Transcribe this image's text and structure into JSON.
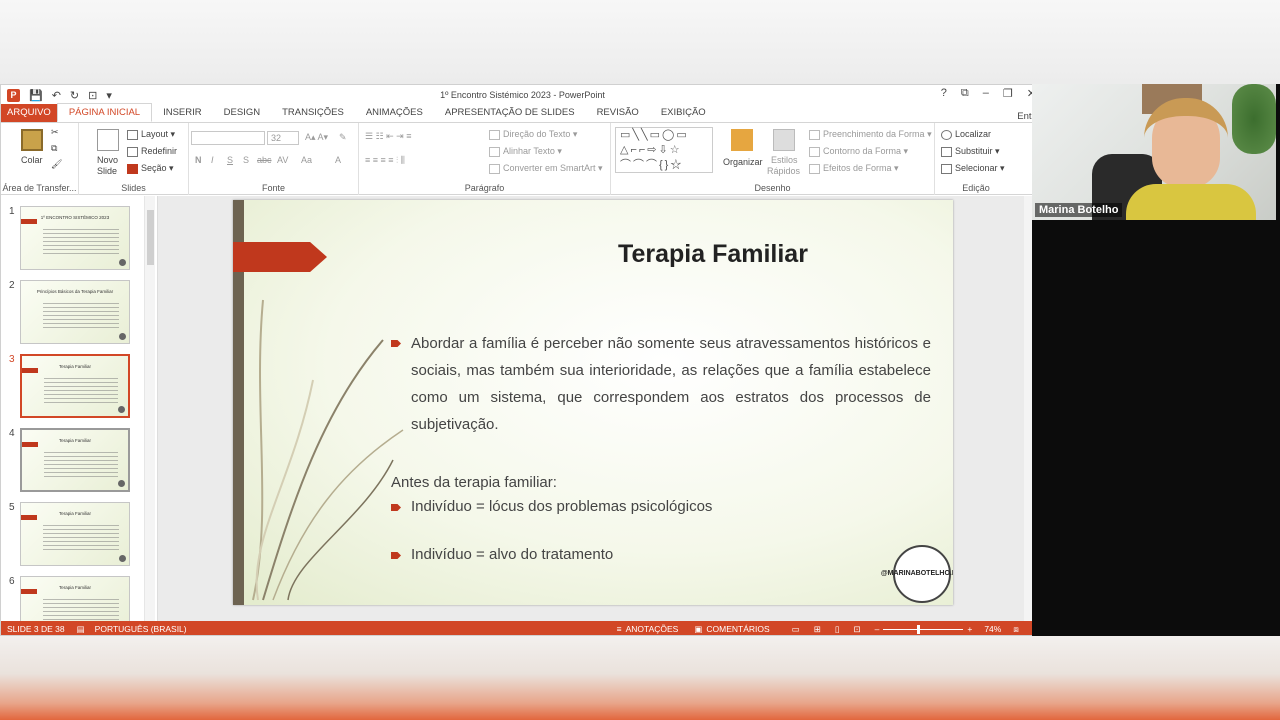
{
  "window": {
    "title": "1º Encontro Sistémico 2023 - PowerPoint",
    "controls": [
      "?",
      "⧉",
      "–",
      "❐",
      "✕"
    ]
  },
  "tabs": [
    "ARQUIVO",
    "PÁGINA INICIAL",
    "INSERIR",
    "DESIGN",
    "TRANSIÇÕES",
    "ANIMAÇÕES",
    "APRESENTAÇÃO DE SLIDES",
    "REVISÃO",
    "EXIBIÇÃO"
  ],
  "tab_right": "Entra",
  "ribbon": {
    "clipboard": {
      "paste": "Colar",
      "label": "Área de Transfer..."
    },
    "slides": {
      "new_slide_1": "Novo",
      "new_slide_2": "Slide",
      "layout": "Layout",
      "reset": "Redefinir",
      "section": "Seção",
      "label": "Slides"
    },
    "font": {
      "size": "32",
      "label": "Fonte",
      "buttons": [
        "N",
        "I",
        "S",
        "S",
        "abc",
        "AV",
        "Aa",
        "A"
      ]
    },
    "paragraph": {
      "text_direction": "Direção do Texto",
      "align_text": "Alinhar Texto",
      "smartart": "Converter em SmartArt",
      "label": "Parágrafo"
    },
    "drawing": {
      "arrange": "Organizar",
      "styles_1": "Estilos",
      "styles_2": "Rápidos",
      "fill": "Preenchimento da Forma",
      "outline": "Contorno da Forma",
      "effects": "Efeitos de Forma",
      "label": "Desenho"
    },
    "editing": {
      "find": "Localizar",
      "replace": "Substituir",
      "select": "Selecionar",
      "label": "Edição"
    }
  },
  "thumbnails": [
    {
      "num": "1",
      "title": "1º ENCONTRO SISTÊMICO 2023"
    },
    {
      "num": "2",
      "title": "Princípios Básicos da Terapia Familiar"
    },
    {
      "num": "3",
      "title": "Terapia Familiar"
    },
    {
      "num": "4",
      "title": "Terapia Familiar"
    },
    {
      "num": "5",
      "title": "Terapia Familiar"
    },
    {
      "num": "6",
      "title": "Terapia Familiar"
    }
  ],
  "slide": {
    "title": "Terapia Familiar",
    "paragraph": "Abordar a família é perceber não somente seus atravessamentos históricos e sociais, mas também sua interioridade, as relações que a família estabelece como um sistema, que correspondem aos estratos dos processos de subjetivação.",
    "subheading": "Antes da terapia familiar:",
    "bullet_1": "Indivíduo = lócus dos problemas psicológicos",
    "bullet_2": "Indivíduo = alvo do tratamento",
    "seal_text": "@MARINABOTELHO.PSI"
  },
  "status": {
    "slide_count": "SLIDE 3 DE 38",
    "language": "PORTUGUÊS (BRASIL)",
    "notes": "ANOTAÇÕES",
    "comments": "COMENTÁRIOS",
    "zoom": "74%"
  },
  "webcam": {
    "name": "Marina Botelho"
  },
  "colors": {
    "accent": "#d24726",
    "slide_flag": "#c0381d",
    "slide_bar": "#6d6351"
  }
}
